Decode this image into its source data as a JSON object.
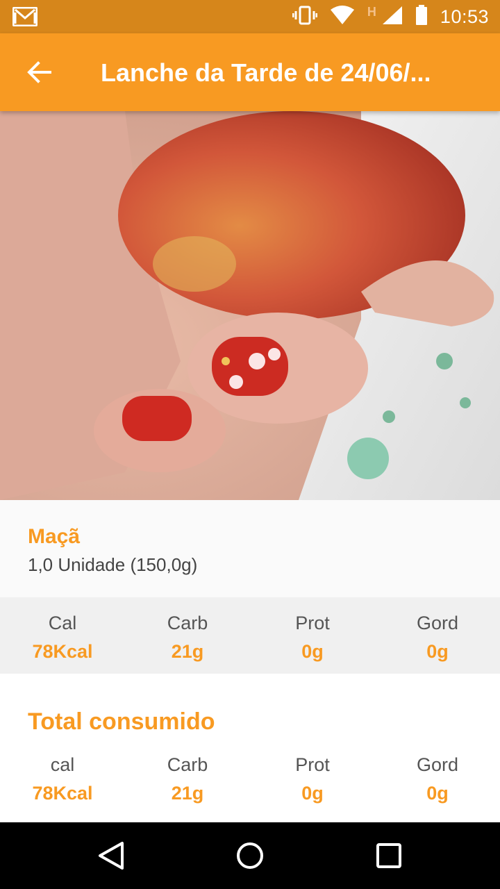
{
  "status_bar": {
    "time": "10:53",
    "network_label": "H"
  },
  "app_bar": {
    "title": "Lanche da Tarde de 24/06/..."
  },
  "food_item": {
    "name": "Maçã",
    "portion": "1,0 Unidade (150,0g)"
  },
  "item_macros": [
    {
      "label": "Cal",
      "value": "78Kcal"
    },
    {
      "label": "Carb",
      "value": "21g"
    },
    {
      "label": "Prot",
      "value": "0g"
    },
    {
      "label": "Gord",
      "value": "0g"
    }
  ],
  "total": {
    "title": "Total consumido",
    "macros": [
      {
        "label": "cal",
        "value": "78Kcal"
      },
      {
        "label": "Carb",
        "value": "21g"
      },
      {
        "label": "Prot",
        "value": "0g"
      },
      {
        "label": "Gord",
        "value": "0g"
      }
    ]
  },
  "colors": {
    "status_bar": "#d6861b",
    "app_bar": "#f89a22",
    "accent": "#f89a22"
  },
  "icons": [
    "gmail-icon",
    "vibrate-icon",
    "wifi-icon",
    "signal-icon",
    "battery-icon",
    "back-arrow-icon",
    "heart-icon",
    "nav-back-icon",
    "nav-home-icon",
    "nav-recents-icon"
  ]
}
